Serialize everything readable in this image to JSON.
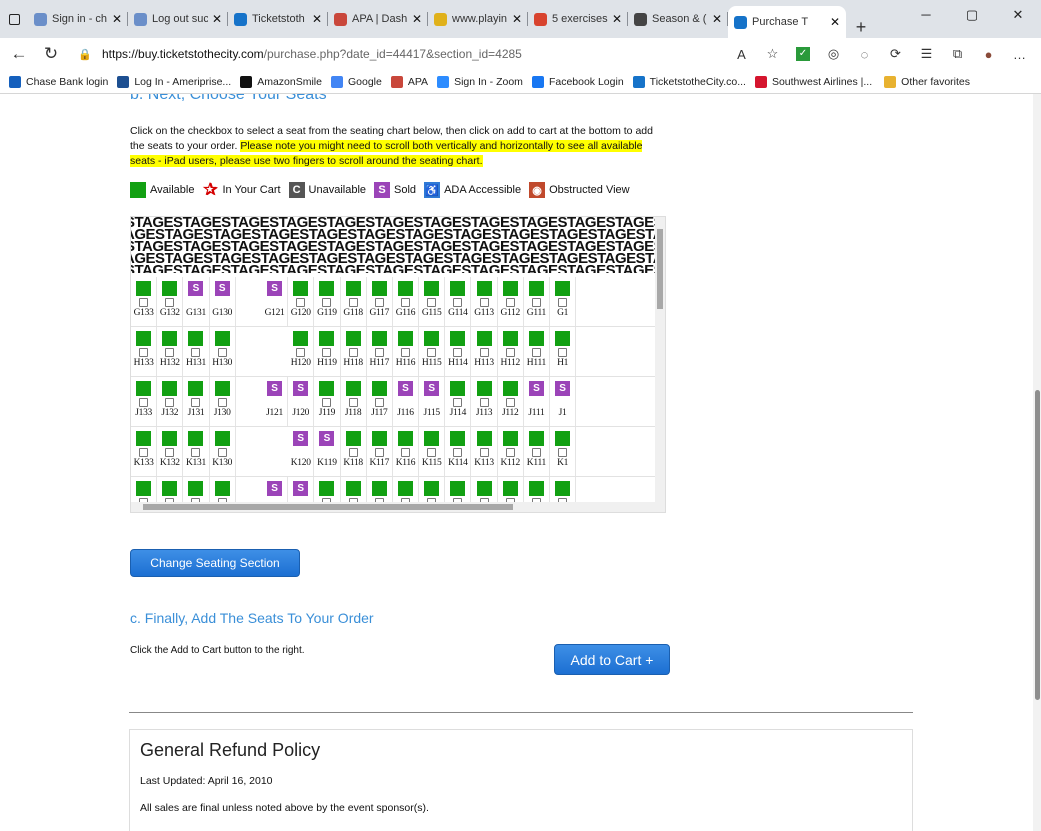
{
  "browser": {
    "tabs": [
      {
        "title": "Sign in - ch",
        "color": "#6b8fc9"
      },
      {
        "title": "Log out suc",
        "color": "#6b8fc9"
      },
      {
        "title": "Ticketstoth",
        "color": "#1673c9"
      },
      {
        "title": "APA | Dash",
        "color": "#c9473b"
      },
      {
        "title": "www.playin",
        "color": "#e0b11a"
      },
      {
        "title": "5 exercises",
        "color": "#d8432e"
      },
      {
        "title": "Season & (",
        "color": "#444"
      },
      {
        "title": "Purchase T",
        "color": "#1673c9"
      }
    ],
    "url_host": "https://buy.ticketstothecity.com",
    "url_path": "/purchase.php?date_id=44417&section_id=4285",
    "bookmarks": [
      "Chase Bank login",
      "Log In - Ameriprise...",
      "AmazonSmile",
      "Google",
      "APA",
      "Sign In - Zoom",
      "Facebook Login",
      "TicketstotheCity.co...",
      "Southwest Airlines |...",
      "Other favorites"
    ]
  },
  "page": {
    "section_b_title": "b. Next, Choose Your Seats",
    "instructions": "Click on the checkbox to select a seat from the seating chart below, then click on add to cart at the bottom to add the seats to your order.",
    "highlight_note": "Please note you might need to scroll both vertically and horizontally to see all available seats - iPad users, please use two fingers to scroll around the seating chart.",
    "legend": {
      "available": "Available",
      "in_cart": "In Your Cart",
      "unavailable": "Unavailable",
      "sold": "Sold",
      "ada": "ADA Accessible",
      "obstructed": "Obstructed View",
      "unavailable_glyph": "C",
      "sold_glyph": "S"
    },
    "stage_text": "STAGE",
    "seat_rows": [
      [
        [
          "G133",
          "av"
        ],
        [
          "G132",
          "av"
        ],
        [
          "G131",
          "sd"
        ],
        [
          "G130",
          "sd"
        ],
        [
          "",
          ""
        ],
        [
          "G121",
          "sd"
        ],
        [
          "G120",
          "av"
        ],
        [
          "G119",
          "av"
        ],
        [
          "G118",
          "av"
        ],
        [
          "G117",
          "av"
        ],
        [
          "G116",
          "av"
        ],
        [
          "G115",
          "av"
        ],
        [
          "G114",
          "av"
        ],
        [
          "G113",
          "av"
        ],
        [
          "G112",
          "av"
        ],
        [
          "G111",
          "av"
        ],
        [
          "G1",
          "av"
        ]
      ],
      [
        [
          "H133",
          "av"
        ],
        [
          "H132",
          "av"
        ],
        [
          "H131",
          "av"
        ],
        [
          "H130",
          "av"
        ],
        [
          "",
          ""
        ],
        [
          "",
          ""
        ],
        [
          "H120",
          "av"
        ],
        [
          "H119",
          "av"
        ],
        [
          "H118",
          "av"
        ],
        [
          "H117",
          "av"
        ],
        [
          "H116",
          "av"
        ],
        [
          "H115",
          "av"
        ],
        [
          "H114",
          "av"
        ],
        [
          "H113",
          "av"
        ],
        [
          "H112",
          "av"
        ],
        [
          "H111",
          "av"
        ],
        [
          "H1",
          "av"
        ]
      ],
      [
        [
          "J133",
          "av"
        ],
        [
          "J132",
          "av"
        ],
        [
          "J131",
          "av"
        ],
        [
          "J130",
          "av"
        ],
        [
          "",
          ""
        ],
        [
          "J121",
          "sd"
        ],
        [
          "J120",
          "sd"
        ],
        [
          "J119",
          "av"
        ],
        [
          "J118",
          "av"
        ],
        [
          "J117",
          "av"
        ],
        [
          "J116",
          "sd"
        ],
        [
          "J115",
          "sd"
        ],
        [
          "J114",
          "av"
        ],
        [
          "J113",
          "av"
        ],
        [
          "J112",
          "av"
        ],
        [
          "J111",
          "sd"
        ],
        [
          "J1",
          "sd"
        ]
      ],
      [
        [
          "K133",
          "av"
        ],
        [
          "K132",
          "av"
        ],
        [
          "K131",
          "av"
        ],
        [
          "K130",
          "av"
        ],
        [
          "",
          ""
        ],
        [
          "",
          ""
        ],
        [
          "K120",
          "sd"
        ],
        [
          "K119",
          "sd"
        ],
        [
          "K118",
          "av"
        ],
        [
          "K117",
          "av"
        ],
        [
          "K116",
          "av"
        ],
        [
          "K115",
          "av"
        ],
        [
          "K114",
          "av"
        ],
        [
          "K113",
          "av"
        ],
        [
          "K112",
          "av"
        ],
        [
          "K111",
          "av"
        ],
        [
          "K1",
          "av"
        ]
      ],
      [
        [
          "",
          "av"
        ],
        [
          "",
          "av"
        ],
        [
          "",
          "av"
        ],
        [
          "",
          "av"
        ],
        [
          "",
          ""
        ],
        [
          "",
          "sd"
        ],
        [
          "",
          "sd"
        ],
        [
          "",
          "av"
        ],
        [
          "",
          "av"
        ],
        [
          "",
          "av"
        ],
        [
          "",
          "av"
        ],
        [
          "",
          "av"
        ],
        [
          "",
          "av"
        ],
        [
          "",
          "av"
        ],
        [
          "",
          "av"
        ],
        [
          "",
          "av"
        ],
        [
          "",
          "av"
        ]
      ]
    ],
    "change_section_label": "Change Seating Section",
    "section_c_title": "c. Finally, Add The Seats To Your Order",
    "cart_note": "Click the Add to Cart button to the right.",
    "add_to_cart_label": "Add to Cart +",
    "refund_title": "General Refund Policy",
    "refund_updated": "Last Updated: April 16, 2010",
    "refund_text": "All sales are final unless noted above by the event sponsor(s)."
  },
  "colors": {
    "available": "#12a012",
    "sold": "#9b44b8",
    "unavailable": "#555555",
    "ada": "#2f7ad6",
    "obstructed": "#c0492c",
    "cart_star": "#d40000",
    "link_heading": "#3a8fd8"
  }
}
